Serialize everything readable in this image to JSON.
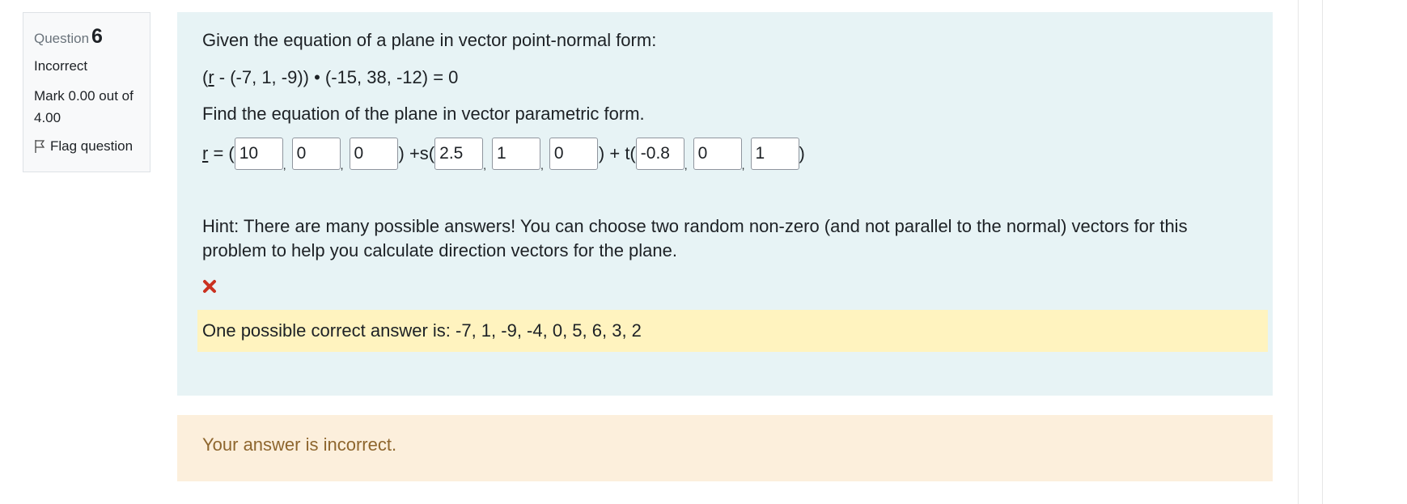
{
  "question_info": {
    "label": "Question",
    "number": "6",
    "state": "Incorrect",
    "grade": "Mark 0.00 out of 4.00",
    "flag_label": "Flag question"
  },
  "formulation": {
    "intro": "Given the equation of a plane in vector point-normal form:",
    "equation_prefix": "(",
    "equation_var": "r",
    "equation_rest": " - (-7, 1, -9)) • (-15, 38, -12) = 0",
    "task": "Find the equation of the plane in vector parametric form.",
    "param": {
      "var": "r",
      "eq_open": " = (",
      "s_open": ") +s(",
      "t_open": ") + t(",
      "close": ")",
      "sep": ",",
      "point_values": [
        "10",
        "0",
        "0"
      ],
      "s_values": [
        "2.5",
        "1",
        "0"
      ],
      "t_values": [
        "-0.8",
        "0",
        "1"
      ]
    },
    "hint": "Hint: There are many possible answers! You can choose two random non-zero (and not parallel to the normal) vectors for this problem to help you calculate direction vectors for the plane.",
    "right_answer": "One possible correct answer is: -7, 1, -9, -4, 0, 5, 6, 3, 2"
  },
  "outcome": {
    "feedback": "Your answer is incorrect."
  },
  "colors": {
    "formulation_bg": "#e7f3f5",
    "rightanswer_bg": "#fff3bf",
    "outcome_bg": "#fcefdc",
    "incorrect_icon": "#ca3120",
    "outcome_text": "#8e662e"
  },
  "icons": {
    "flag": "flag-outline-icon",
    "incorrect": "cross-mark-icon"
  }
}
